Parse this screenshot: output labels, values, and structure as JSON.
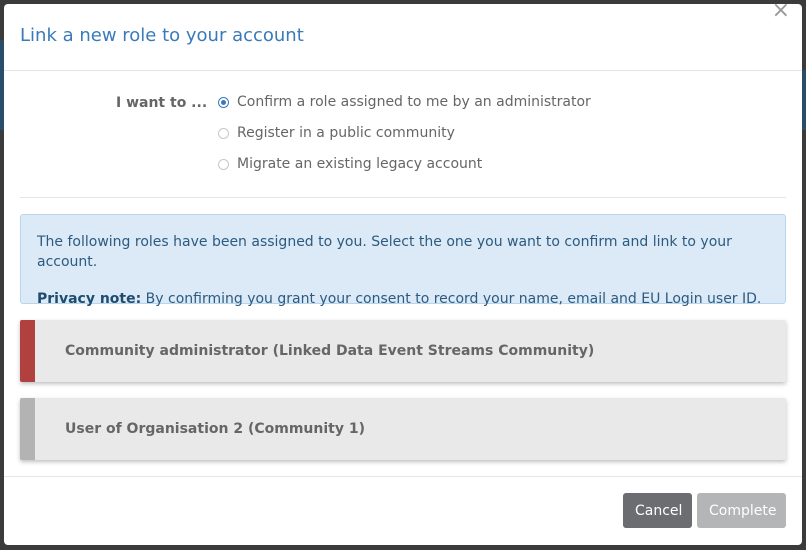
{
  "dialog": {
    "title": "Link a new role to your account",
    "close_glyph": "×"
  },
  "intent": {
    "label": "I want to ...",
    "options": [
      {
        "label": "Confirm a role assigned to me by an administrator",
        "checked": true
      },
      {
        "label": "Register in a public community",
        "checked": false
      },
      {
        "label": "Migrate an existing legacy account",
        "checked": false
      }
    ]
  },
  "info": {
    "message": "The following roles have been assigned to you. Select the one you want to confirm and link to your account.",
    "privacy_label": "Privacy note:",
    "privacy_text": " By confirming you grant your consent to record your name, email and EU Login user ID."
  },
  "roles": [
    {
      "label": "Community administrator (Linked Data Event Streams Community)",
      "color": "#b0413e"
    },
    {
      "label": "User of Organisation 2 (Community 1)",
      "color": "#b3b3b3"
    }
  ],
  "footer": {
    "cancel_label": "Cancel",
    "complete_label": "Complete"
  },
  "colors": {
    "accent": "#3a7ab8",
    "info_bg": "#dbeaf6"
  }
}
